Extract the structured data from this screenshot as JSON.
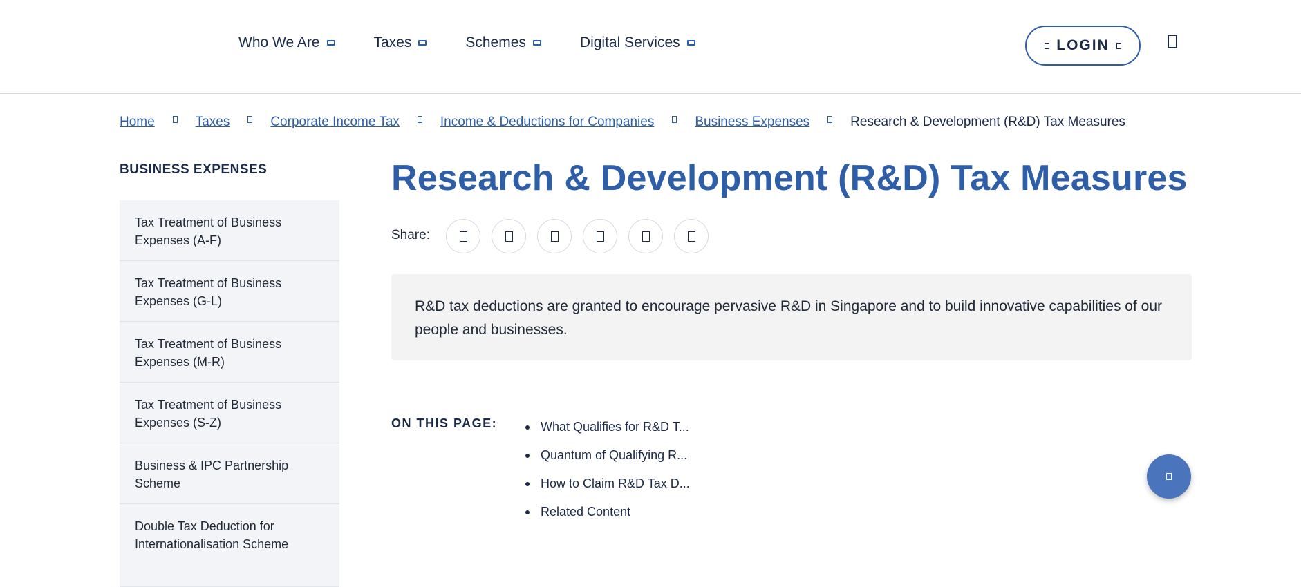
{
  "nav": {
    "items": [
      {
        "label": "Who We Are"
      },
      {
        "label": "Taxes"
      },
      {
        "label": "Schemes"
      },
      {
        "label": "Digital Services"
      }
    ],
    "login_label": "LOGIN"
  },
  "breadcrumb": {
    "links": [
      "Home",
      "Taxes",
      "Corporate Income Tax",
      "Income & Deductions for Companies",
      "Business Expenses"
    ],
    "current": "Research & Development (R&D) Tax Measures"
  },
  "sidebar": {
    "heading": "BUSINESS EXPENSES",
    "items": [
      "Tax Treatment of Business Expenses (A-F)",
      "Tax Treatment of Business Expenses (G-L)",
      "Tax Treatment of Business Expenses (M-R)",
      "Tax Treatment of Business Expenses (S-Z)",
      "Business & IPC Partnership Scheme",
      "Double Tax Deduction for Internationalisation Scheme"
    ]
  },
  "main": {
    "title": "Research & Development (R&D) Tax Measures",
    "share_label": "Share:",
    "intro": "R&D tax deductions are granted to encourage pervasive R&D in Singapore and to build innovative capabilities of our people and businesses.",
    "toc_label": "ON THIS PAGE:",
    "toc_items": [
      "What Qualifies for R&D T...",
      "Quantum of Qualifying R...",
      "How to Claim R&D Tax D...",
      "Related Content"
    ]
  },
  "colors": {
    "brand_blue": "#2f5ea8",
    "nav_text": "#1b2a48",
    "sidebar_bg": "#f2f4f8",
    "intro_bg": "#f3f3f4"
  }
}
